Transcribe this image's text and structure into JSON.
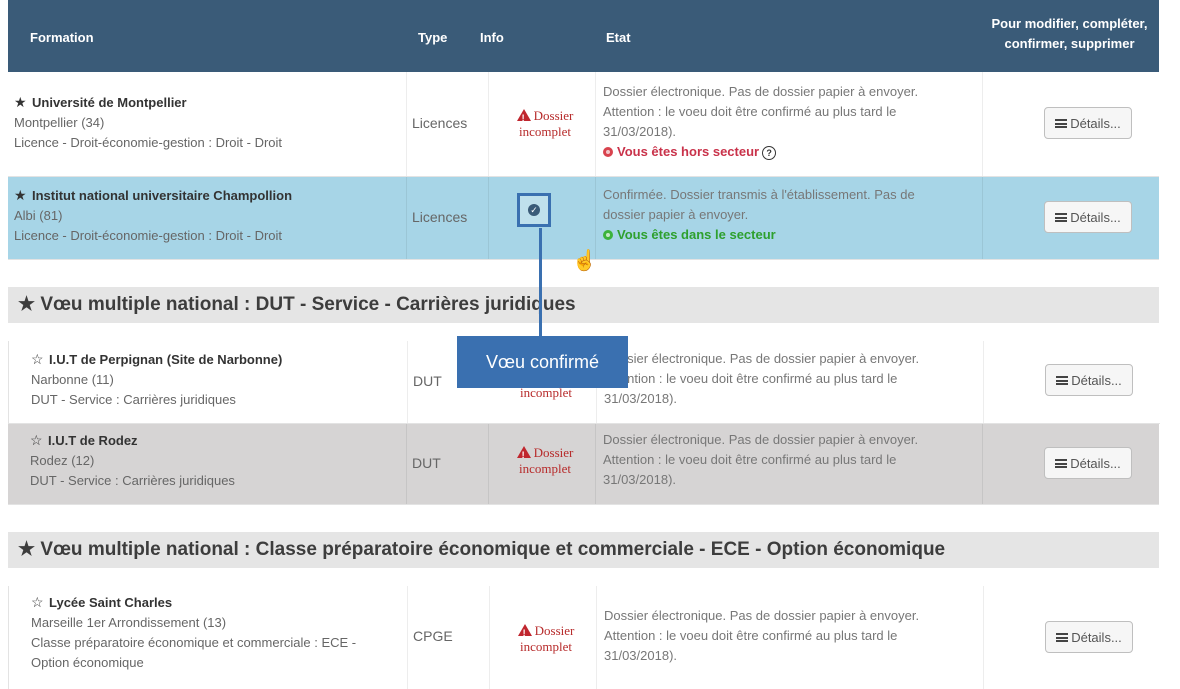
{
  "header": {
    "formation": "Formation",
    "type": "Type",
    "info": "Info",
    "etat": "Etat",
    "actions_line1": "Pour modifier, compléter,",
    "actions_line2": "confirmer, supprimer"
  },
  "rows": [
    {
      "star": "★",
      "institution": "Université de Montpellier",
      "city": "Montpellier (34)",
      "diploma": "Licence - Droit-économie-gestion : Droit - Droit",
      "type": "Licences",
      "info_line1": "Dossier",
      "info_line2": "incomplet",
      "etat_line1": "Dossier électronique. Pas de dossier papier à envoyer.",
      "etat_line2": "Attention : le voeu doit être confirmé au plus tard le",
      "etat_line3": "31/03/2018).",
      "sector": "Vous êtes hors secteur",
      "details": "Détails..."
    },
    {
      "star": "★",
      "institution": "Institut national universitaire Champollion",
      "city": "Albi (81)",
      "diploma": "Licence - Droit-économie-gestion : Droit - Droit",
      "type": "Licences",
      "info_icon": "check-circle-icon",
      "etat_line1": "Confirmée. Dossier transmis à l'établissement. Pas de",
      "etat_line2": "dossier papier à envoyer.",
      "sector": "Vous êtes dans le secteur",
      "details": "Détails..."
    }
  ],
  "group1": {
    "star": "★",
    "title": "Vœu multiple national : DUT - Service - Carrières juridiques",
    "rows": [
      {
        "star": "☆",
        "institution": "I.U.T de Perpignan (Site de Narbonne)",
        "city": "Narbonne (11)",
        "diploma": "DUT - Service : Carrières juridiques",
        "type": "DUT",
        "info_line2": "incomplet",
        "etat_line1": "Dossier électronique. Pas de dossier papier à envoyer.",
        "etat_line2": "Attention : le voeu doit être confirmé au plus tard le",
        "etat_line3": "31/03/2018).",
        "details": "Détails..."
      },
      {
        "star": "☆",
        "institution": "I.U.T de Rodez",
        "city": "Rodez (12)",
        "diploma": "DUT - Service : Carrières juridiques",
        "type": "DUT",
        "info_line1": "Dossier",
        "info_line2": "incomplet",
        "etat_line1": "Dossier électronique. Pas de dossier papier à envoyer.",
        "etat_line2": "Attention : le voeu doit être confirmé au plus tard le",
        "etat_line3": "31/03/2018).",
        "details": "Détails..."
      }
    ]
  },
  "group2": {
    "star": "★",
    "title": "Vœu multiple national : Classe préparatoire économique et commerciale - ECE - Option économique",
    "rows": [
      {
        "star": "☆",
        "institution": "Lycée Saint Charles",
        "city": "Marseille 1er Arrondissement (13)",
        "diploma_line1": "Classe préparatoire économique et commerciale : ECE -",
        "diploma_line2": "Option économique",
        "type": "CPGE",
        "info_line1": "Dossier",
        "info_line2": "incomplet",
        "etat_line1": "Dossier électronique. Pas de dossier papier à envoyer.",
        "etat_line2": "Attention : le voeu doit être confirmé au plus tard le",
        "etat_line3": "31/03/2018).",
        "details": "Détails..."
      }
    ]
  },
  "annotation": {
    "callout": "Vœu confirmé",
    "check_glyph": "✓"
  },
  "colors": {
    "header_bg": "#3a5b78",
    "highlight_row": "#a7d5e7",
    "grey_row": "#d6d4d4",
    "incomplete_red": "#b72b2b",
    "in_sector_green": "#2ea02e",
    "out_sector_red": "#c9324a",
    "callout_blue": "#3a70b0"
  }
}
